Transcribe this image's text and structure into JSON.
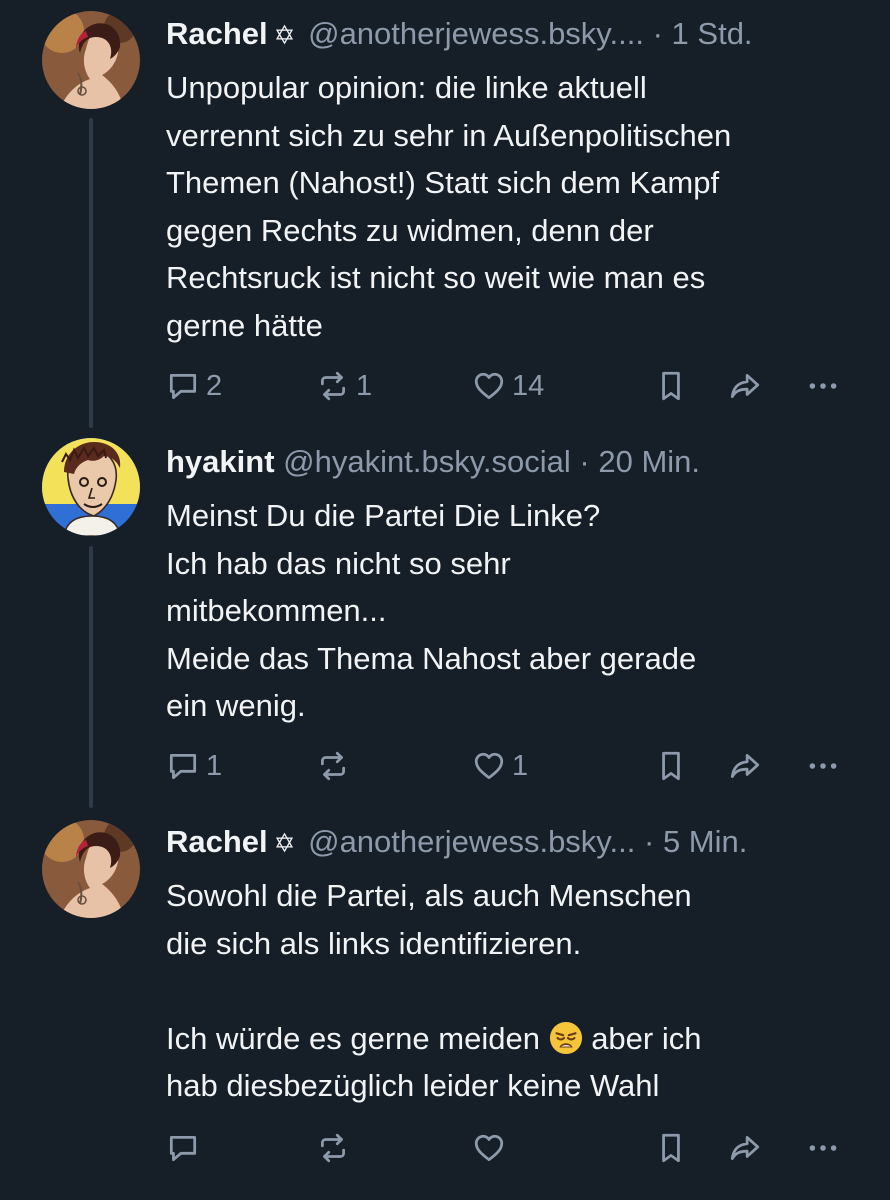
{
  "posts": [
    {
      "name": "Rachel",
      "badge": "✡",
      "handle": "@anotherjewess.bsky....",
      "dot": "·",
      "time": "1 Std.",
      "lines": [
        "Unpopular opinion: die linke aktuell",
        "verrennt sich zu sehr in Außenpolitischen",
        "Themen (Nahost!) Statt sich dem Kampf",
        "gegen Rechts zu widmen, denn der",
        "Rechtsruck ist nicht so weit wie man es",
        "gerne hätte"
      ],
      "replies": "2",
      "reposts": "1",
      "likes": "14"
    },
    {
      "name": "hyakint",
      "handle": "@hyakint.bsky.social",
      "dot": "·",
      "time": "20 Min.",
      "lines": [
        "Meinst Du die Partei Die Linke?",
        "Ich hab das nicht so sehr",
        "mitbekommen...",
        "Meide das Thema Nahost aber gerade",
        "ein wenig."
      ],
      "replies": "1",
      "reposts": "",
      "likes": "1"
    },
    {
      "name": "Rachel",
      "badge": "✡",
      "handle": "@anotherjewess.bsky...",
      "dot": "·",
      "time": "5 Min.",
      "lines": [
        "Sowohl die Partei, als auch Menschen",
        "die sich als links identifizieren.",
        "",
        "Ich würde es gerne meiden",
        "hab diesbezüglich leider keine Wahl"
      ],
      "line4_after_emoji": "aber ich",
      "emoji": "weary-face",
      "replies": "",
      "reposts": "",
      "likes": ""
    }
  ],
  "colors": {
    "background": "#161e27",
    "text": "#f1f3f5",
    "muted": "#8d9aab",
    "thread_line": "#2e3a4a"
  },
  "icons": [
    "reply-icon",
    "repost-icon",
    "like-icon",
    "bookmark-icon",
    "share-icon",
    "more-icon"
  ]
}
